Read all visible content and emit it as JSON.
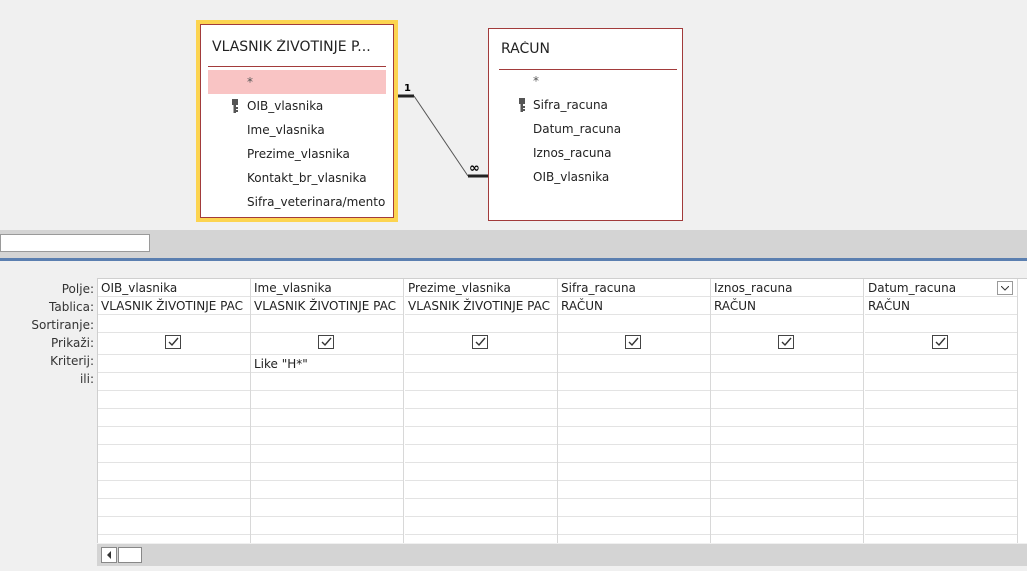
{
  "diagram": {
    "owner_table": {
      "title": "VLASNIK ŽIVOTINJE P...",
      "fields": [
        "*",
        "OIB_vlasnika",
        "Ime_vlasnika",
        "Prezime_vlasnika",
        "Kontakt_br_vlasnika",
        "Sifra_veterinara/mento"
      ],
      "key_field": "OIB_vlasnika"
    },
    "racun_table": {
      "title": "RAČUN",
      "fields": [
        "*",
        "Sifra_racuna",
        "Datum_racuna",
        "Iznos_racuna",
        "OIB_vlasnika"
      ],
      "key_field": "Sifra_racuna"
    },
    "relationship": {
      "one_label": "1",
      "many_label": "∞"
    }
  },
  "grid": {
    "row_labels": {
      "polje": "Polje:",
      "tablica": "Tablica:",
      "sortiranje": "Sortiranje:",
      "prikazi": "Prikaži:",
      "kriterij": "Kriterij:",
      "ili": "ili:"
    },
    "columns": [
      {
        "field": "OIB_vlasnika",
        "table": "VLASNIK ŽIVOTINJE PAC",
        "show": true,
        "criteria": ""
      },
      {
        "field": "Ime_vlasnika",
        "table": "VLASNIK ŽIVOTINJE PAC",
        "show": true,
        "criteria": "Like \"H*\""
      },
      {
        "field": "Prezime_vlasnika",
        "table": "VLASNIK ŽIVOTINJE PAC",
        "show": true,
        "criteria": ""
      },
      {
        "field": "Sifra_racuna",
        "table": "RAČUN",
        "show": true,
        "criteria": ""
      },
      {
        "field": "Iznos_racuna",
        "table": "RAČUN",
        "show": true,
        "criteria": ""
      },
      {
        "field": "Datum_racuna",
        "table": "RAČUN",
        "show": true,
        "criteria": ""
      }
    ]
  },
  "colors": {
    "table_border": "#a23b3b",
    "selected_table_outline": "#fcd450",
    "star_row_highlight": "#f9c4c4",
    "splitter_line": "#5b7fb0"
  },
  "icons": {
    "key": "key-icon",
    "checkbox": "checkmark-icon",
    "dropdown": "chevron-down-icon",
    "scroll_left": "arrow-left-icon"
  }
}
